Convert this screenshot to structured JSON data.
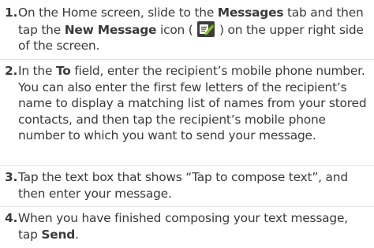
{
  "steps": [
    {
      "number": "1.",
      "parts": {
        "a": "On the Home screen, slide to the ",
        "b": "Messages",
        "c": " tab and then tap the ",
        "d": "New Message",
        "e": " icon ( ",
        "f": " ) on the upper right side of the screen."
      },
      "icon": "new-message-icon"
    },
    {
      "number": "2.",
      "parts": {
        "a": "In the ",
        "b": "To",
        "c": " field, enter the recipient’s mobile phone number. You can also enter the first few letters of the recipient’s name to display a matching list of names from your stored contacts, and then tap the recipient’s mobile phone number to which you want to send your message."
      }
    },
    {
      "number": "3.",
      "parts": {
        "a": "Tap the text box that shows “Tap to compose text”, and then enter your message."
      }
    },
    {
      "number": "4.",
      "parts": {
        "a": "When you have finished composing your text message, tap ",
        "b": "Send",
        "c": "."
      }
    }
  ],
  "colors": {
    "text": "#3a3a3a",
    "separator": "#e2e2e2",
    "icon_bg": "#3d3d3d"
  }
}
